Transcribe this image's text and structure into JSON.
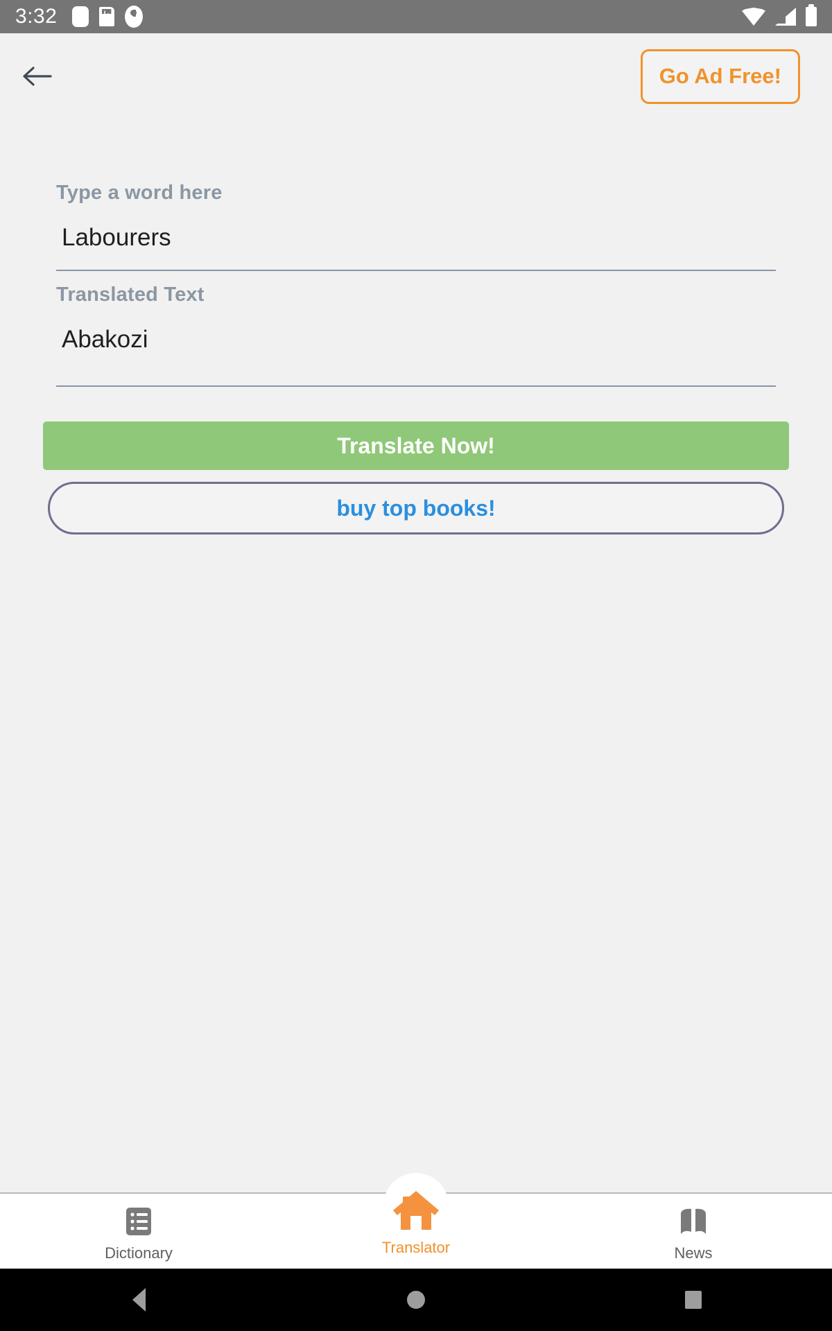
{
  "status_bar": {
    "time": "3:32",
    "left_icons": [
      "app-notification-icon",
      "sd-card-icon",
      "circle-notification-icon"
    ],
    "right_icons": [
      "wifi-icon",
      "cellular-signal-icon",
      "battery-icon"
    ],
    "background_color": "#757575"
  },
  "app_bar": {
    "back_icon": "back-arrow-icon",
    "ad_free_label": "Go Ad Free!",
    "ad_free_color": "#f0922b"
  },
  "form": {
    "source_label": "Type a word here",
    "source_value": "Labourers",
    "source_placeholder": "Type a word here",
    "target_label": "Translated Text",
    "target_value": "Abakozi",
    "target_placeholder": "Translated Text"
  },
  "actions": {
    "translate_label": "Translate Now!",
    "translate_color": "#8fc878",
    "books_label": "buy top books!",
    "books_text_color": "#2a8fe0",
    "books_border_color": "#6e6e8f"
  },
  "bottom_nav": {
    "items": [
      {
        "label": "Dictionary",
        "icon": "list-icon",
        "active": false
      },
      {
        "label": "Translator",
        "icon": "home-icon",
        "active": true
      },
      {
        "label": "News",
        "icon": "book-icon",
        "active": false
      }
    ],
    "active_color": "#f0922b",
    "inactive_color": "#5f5f5f"
  },
  "system_nav": {
    "back_icon": "system-back-icon",
    "home_icon": "system-home-icon",
    "recents_icon": "system-recents-icon"
  }
}
